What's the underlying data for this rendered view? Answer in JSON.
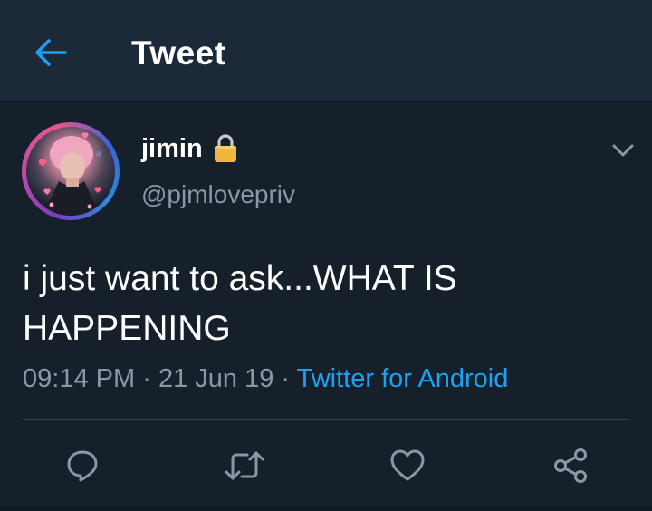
{
  "header": {
    "title": "Tweet",
    "back_icon": "arrow-left-icon"
  },
  "tweet": {
    "display_name": "jimin",
    "protected_icon": "lock-icon",
    "handle": "@pjmlovepriv",
    "text": "i just want to ask...WHAT IS HAPPENING",
    "time": "09:14 PM",
    "separator": "·",
    "date": "21 Jun 19",
    "source": "Twitter for Android",
    "menu_icon": "chevron-down-icon"
  },
  "actions": [
    {
      "name": "reply",
      "icon": "reply-icon"
    },
    {
      "name": "retweet",
      "icon": "retweet-icon"
    },
    {
      "name": "like",
      "icon": "heart-icon"
    },
    {
      "name": "share",
      "icon": "share-icon"
    }
  ],
  "colors": {
    "background": "#15202b",
    "header_background": "#1c2938",
    "accent": "#1da1f2",
    "secondary_text": "#8899a6",
    "primary_text": "#ffffff"
  }
}
